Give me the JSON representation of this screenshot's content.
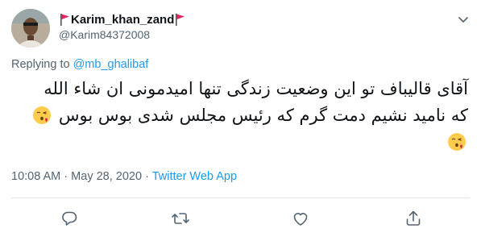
{
  "author": {
    "display_name": "Karim_khan_zand",
    "handle": "@Karim84372008",
    "avatar_icon": "user-avatar-photo",
    "flag_icon": "red-flag-emoji"
  },
  "reply": {
    "prefix": "Replying to",
    "mention": "@mb_ghalibaf"
  },
  "tweet": {
    "line1": "آقای قالیباف تو این وضعیت زندگی تنها امیدمونی ان شاء الله",
    "line2": "که نامید نشیم دمت گرم که رئیس مجلس شدی بوس بوس",
    "emoji_icon": "face-blowing-kiss-emoji"
  },
  "meta": {
    "time": "10:08 AM",
    "separator": "·",
    "date": "May 28, 2020",
    "app": "Twitter Web App"
  },
  "actions": [
    "reply-icon",
    "retweet-icon",
    "like-icon",
    "share-icon"
  ],
  "colors": {
    "text": "#0f1419",
    "secondary": "#536471",
    "link": "#1d9bf0",
    "divider": "#e1e8ed",
    "flag": "#e0245e"
  }
}
